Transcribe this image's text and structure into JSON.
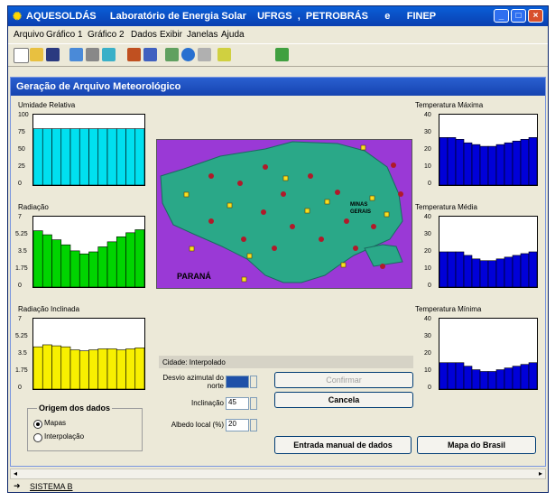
{
  "window": {
    "title": "AQUESOLDÁS     Laboratório de Energia Solar    UFRGS  ,  PETROBRÁS      e      FINEP",
    "buttons": [
      "minimize",
      "maximize",
      "close"
    ]
  },
  "menu": [
    "Arquivo",
    "Gráfico 1",
    "Gráfico 2",
    "Dados",
    "Exibir",
    "Janelas",
    "Ajuda"
  ],
  "toolbar_icons": [
    "new-icon",
    "open-icon",
    "save-icon",
    "tool-1-icon",
    "tool-2-icon",
    "tool-3-icon",
    "tool-4-icon",
    "tool-5-icon",
    "tool-6-icon",
    "globe-icon",
    "tool-7-icon",
    "tool-8-icon",
    "exit-icon"
  ],
  "dialog": {
    "title": "Geração de Arquivo Meteorológico",
    "charts": {
      "umidade": {
        "title": "Umidade Relativa",
        "ticks": [
          "100",
          "75",
          "50",
          "25",
          "0"
        ]
      },
      "radiacao": {
        "title": "Radiação",
        "ticks": [
          "7",
          "5.25",
          "3.5",
          "1.75",
          "0"
        ]
      },
      "radiacao_inclinada": {
        "title": "Radiação Inclinada",
        "ticks": [
          "7",
          "5.25",
          "3.5",
          "1.75",
          "0"
        ]
      },
      "temp_max": {
        "title": "Temperatura Máxima",
        "ticks": [
          "40",
          "30",
          "20",
          "10",
          "0"
        ]
      },
      "temp_media": {
        "title": "Temperatura Média",
        "ticks": [
          "40",
          "30",
          "20",
          "10",
          "0"
        ]
      },
      "temp_min": {
        "title": "Temperatura Mínima",
        "ticks": [
          "40",
          "30",
          "20",
          "10",
          "0"
        ]
      }
    },
    "map": {
      "labels": [
        "PARANÁ",
        "MINAS GERAIS"
      ]
    },
    "cidade_label": "Cidade: Interpolado",
    "fields": {
      "desvio_label": "Desvio azimutal do norte",
      "desvio_value": "",
      "inclinacao_label": "Inclinação",
      "inclinacao_value": "45",
      "albedo_label": "Albedo local (%)",
      "albedo_value": "20"
    },
    "buttons": {
      "confirmar": "Confirmar",
      "cancela": "Cancela",
      "entrada_manual": "Entrada manual de dados",
      "mapa_brasil": "Mapa do Brasil"
    },
    "origem": {
      "title": "Origem dos dados",
      "options": [
        "Mapas",
        "Interpolação"
      ],
      "selected": "Mapas"
    }
  },
  "statusbar": {
    "text": "SISTEMA B"
  },
  "colors": {
    "cyan": "#00e0f0",
    "green": "#00d400",
    "yellow": "#f8f000",
    "blue": "#0000d8",
    "map_purple": "#9a39d6",
    "map_green": "#2aa888"
  },
  "chart_data": [
    {
      "type": "bar",
      "title": "Umidade Relativa",
      "ylim": [
        0,
        100
      ],
      "values": [
        80,
        80,
        80,
        80,
        80,
        80,
        80,
        80,
        80,
        80,
        80,
        80
      ]
    },
    {
      "type": "bar",
      "title": "Radiação",
      "ylim": [
        0,
        7
      ],
      "values": [
        5.6,
        5.2,
        4.7,
        4.2,
        3.6,
        3.3,
        3.5,
        4.0,
        4.5,
        5.0,
        5.4,
        5.7
      ]
    },
    {
      "type": "bar",
      "title": "Radiação Inclinada",
      "ylim": [
        0,
        7
      ],
      "values": [
        4.2,
        4.4,
        4.3,
        4.2,
        3.9,
        3.8,
        3.9,
        4.0,
        4.0,
        3.9,
        4.0,
        4.1
      ]
    },
    {
      "type": "bar",
      "title": "Temperatura Máxima",
      "ylim": [
        0,
        40
      ],
      "values": [
        27,
        27,
        26,
        24,
        23,
        22,
        22,
        23,
        24,
        25,
        26,
        27
      ]
    },
    {
      "type": "bar",
      "title": "Temperatura Média",
      "ylim": [
        0,
        40
      ],
      "values": [
        20,
        20,
        20,
        18,
        16,
        15,
        15,
        16,
        17,
        18,
        19,
        20
      ]
    },
    {
      "type": "bar",
      "title": "Temperatura Mínima",
      "ylim": [
        0,
        40
      ],
      "values": [
        15,
        15,
        15,
        13,
        11,
        10,
        10,
        11,
        12,
        13,
        14,
        15
      ]
    }
  ]
}
